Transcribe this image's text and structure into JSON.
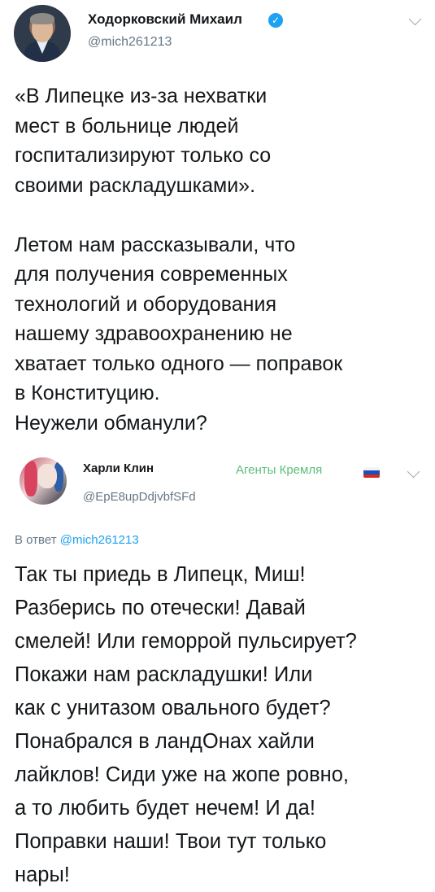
{
  "main_tweet": {
    "author_name": "Ходорковский Михаил",
    "verified": true,
    "handle": "@mich261213",
    "lines": [
      "«В Липецке из-за нехватки",
      "мест в больнице людей",
      "госпитализируют только со",
      "своими раскладушками».",
      "",
      "Летом нам рассказывали, что",
      "для получения современных",
      "технологий и оборудования",
      "нашему здравоохранению не",
      "хватает только одного — поправок",
      "в Конституцию.",
      "Неужели обманули?"
    ],
    "menu_icon": "chevron-down-icon"
  },
  "reply_tweet": {
    "author_name": "Харли Клин",
    "handle": "@EpE8upDdjvbfSFd",
    "label": "Агенты Кремля",
    "flag_icon": "russia-flag-icon",
    "replying_to_prefix": "В ответ",
    "replying_to_mention": "@mich261213",
    "lines": [
      "Так ты приедь в Липецк, Миш!",
      "Разберись по отечески! Давай",
      "смелей! Или геморрой пульсирует?",
      "Покажи нам раскладушки! Или",
      "как с унитазом овального будет?",
      "Понабрался в ландОнах хайли",
      "лайклов! Сиди уже на жопе ровно,",
      "а то любить будет нечем! И да!",
      "Поправки наши! Твои тут только",
      "нары!"
    ],
    "menu_icon": "chevron-down-icon"
  },
  "colors": {
    "link": "#1da1f2",
    "secondary_text": "#657786",
    "label_green": "#5bbf7a",
    "primary_text": "#14171a"
  }
}
